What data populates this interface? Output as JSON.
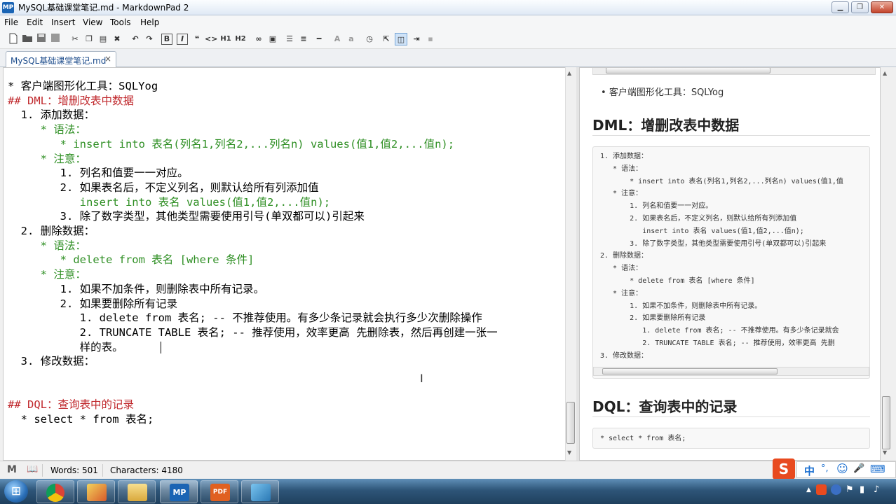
{
  "window": {
    "title": "MySQL基础课堂笔记.md - MarkdownPad 2",
    "logo_text": "MP",
    "minimize": "▁",
    "maximize": "❐",
    "close": "✕"
  },
  "menu": [
    "File",
    "Edit",
    "Insert",
    "View",
    "Tools",
    "Help"
  ],
  "toolbar": {
    "bold": "B",
    "italic": "I",
    "quote": "❝",
    "code": "<>",
    "h1": "H1",
    "h2": "H2",
    "font_up": "A",
    "font_down": "a"
  },
  "tab": {
    "label": "MySQL基础课堂笔记.md",
    "close": "×"
  },
  "editor": {
    "lines": [
      {
        "text": "* 客户端图形化工具：SQLYog",
        "style": "n"
      },
      {
        "text": "## DML：增删改表中数据",
        "style": "h"
      },
      {
        "text": "  1. 添加数据：",
        "style": "n"
      },
      {
        "text": "     * 语法：",
        "style": "g"
      },
      {
        "text": "        * insert into 表名(列名1,列名2,...列名n) values(值1,值2,...值n);",
        "style": "g"
      },
      {
        "text": "     * 注意：",
        "style": "g"
      },
      {
        "text": "        1. 列名和值要一一对应。",
        "style": "n"
      },
      {
        "text": "        2. 如果表名后，不定义列名，则默认给所有列添加值",
        "style": "n"
      },
      {
        "text": "           insert into 表名 values(值1,值2,...值n);",
        "style": "g"
      },
      {
        "text": "        3. 除了数字类型，其他类型需要使用引号(单双都可以)引起来",
        "style": "n"
      },
      {
        "text": "  2. 删除数据：",
        "style": "n"
      },
      {
        "text": "     * 语法：",
        "style": "g"
      },
      {
        "text": "        * delete from 表名 [where 条件]",
        "style": "g"
      },
      {
        "text": "     * 注意：",
        "style": "g"
      },
      {
        "text": "        1. 如果不加条件，则删除表中所有记录。",
        "style": "n"
      },
      {
        "text": "        2. 如果要删除所有记录",
        "style": "n"
      },
      {
        "text": "           1. delete from 表名; -- 不推荐使用。有多少条记录就会执行多少次删除操作",
        "style": "n"
      },
      {
        "text": "           2. TRUNCATE TABLE 表名; -- 推荐使用，效率更高 先删除表，然后再创建一张一",
        "style": "n"
      },
      {
        "text": "           样的表。",
        "style": "n"
      },
      {
        "text": "  3. 修改数据：",
        "style": "n"
      },
      {
        "text": "",
        "style": "n"
      },
      {
        "text": "",
        "style": "n"
      },
      {
        "text": "## DQL：查询表中的记录",
        "style": "h"
      },
      {
        "text": "  * select * from 表名;",
        "style": "n"
      }
    ]
  },
  "preview": {
    "bullet": "客户端图形化工具：SQLYog",
    "heading_dml": "DML：增删改表中数据",
    "code_lines": [
      "1. 添加数据：",
      "   * 语法：",
      "       * insert into 表名(列名1,列名2,...列名n) values(值1,值",
      "   * 注意：",
      "       1. 列名和值要一一对应。",
      "       2. 如果表名后，不定义列名，则默认给所有列添加值",
      "          insert into 表名 values(值1,值2,...值n);",
      "       3. 除了数字类型，其他类型需要使用引号(单双都可以)引起来",
      "2. 删除数据：",
      "   * 语法：",
      "       * delete from 表名 [where 条件]",
      "   * 注意：",
      "       1. 如果不加条件，则删除表中所有记录。",
      "       2. 如果要删除所有记录",
      "          1. delete from 表名; -- 不推荐使用。有多少条记录就会",
      "          2. TRUNCATE TABLE 表名; -- 推荐使用，效率更高 先删",
      "3. 修改数据："
    ],
    "heading_dql": "DQL：查询表中的记录",
    "dql_code": "* select * from 表名;"
  },
  "status": {
    "words_label": "Words: 501",
    "chars_label": "Characters: 4180",
    "markdown_icon": "M",
    "book_icon": "📖"
  },
  "ime": {
    "logo": "S",
    "lang": "中",
    "punct": "°,",
    "emoji": "☺",
    "mic": "🎤",
    "keyboard": "⌨"
  },
  "taskbar": {
    "start": "⊞",
    "apps": [
      "chrome",
      "paint",
      "explorer",
      "MP",
      "PDF",
      "dolphin"
    ],
    "mp_label": "MP",
    "pdf_label": "PDF"
  },
  "tray": {
    "up_arrow": "▲",
    "flag": "⚑",
    "speaker": "♪",
    "network": "▮"
  }
}
